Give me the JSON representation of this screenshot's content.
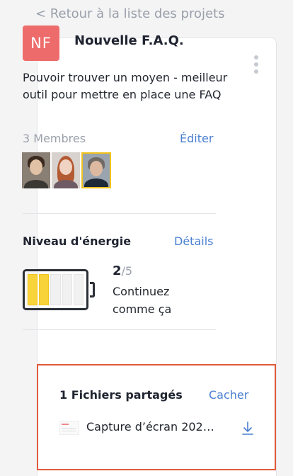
{
  "nav": {
    "back_label": "< Retour à la liste des projets"
  },
  "project": {
    "initials": "NF",
    "title": "Nouvelle F.A.Q.",
    "description": "Pouvoir trouver un moyen - meilleur outil pour mettre en place une FAQ",
    "badge_color": "#ee6b6b"
  },
  "members": {
    "label": "3 Membres",
    "edit_label": "Éditer",
    "avatars": [
      "member-photo",
      "member-photo",
      "member-photo"
    ]
  },
  "energy": {
    "title": "Niveau d'énergie",
    "details_label": "Détails",
    "current": "2",
    "max": "/5",
    "level": 2,
    "level_max": 5,
    "message": "Continuez comme ça",
    "fill_color": "#f8d43a"
  },
  "files": {
    "title": "1 Fichiers partagés",
    "hide_label": "Cacher",
    "items": [
      {
        "name": "Capture d’écran 202…",
        "icon": "download-icon"
      }
    ],
    "highlight_color": "#e05a3c"
  },
  "colors": {
    "link": "#4a7fd0",
    "muted": "#9aa0aa"
  }
}
